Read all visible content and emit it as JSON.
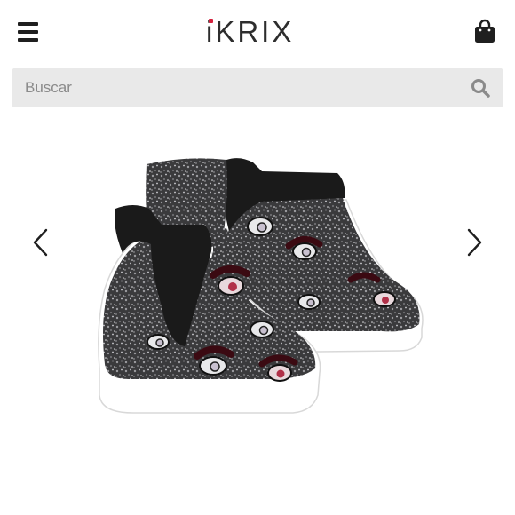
{
  "header": {
    "logo_text": "iKRIX",
    "menu_icon": "hamburger-menu-icon",
    "bag_icon": "shopping-bag-icon"
  },
  "search": {
    "placeholder": "Buscar",
    "value": "",
    "icon": "search-icon"
  },
  "gallery": {
    "prev_icon": "chevron-left-icon",
    "next_icon": "chevron-right-icon",
    "product_image": "glitter-eye-patch-high-top-sneakers"
  },
  "colors": {
    "logo_accent": "#d4213d",
    "logo_text": "#2d2d2d",
    "search_bg": "#e9e9e9",
    "icon": "#1f1f1f"
  }
}
